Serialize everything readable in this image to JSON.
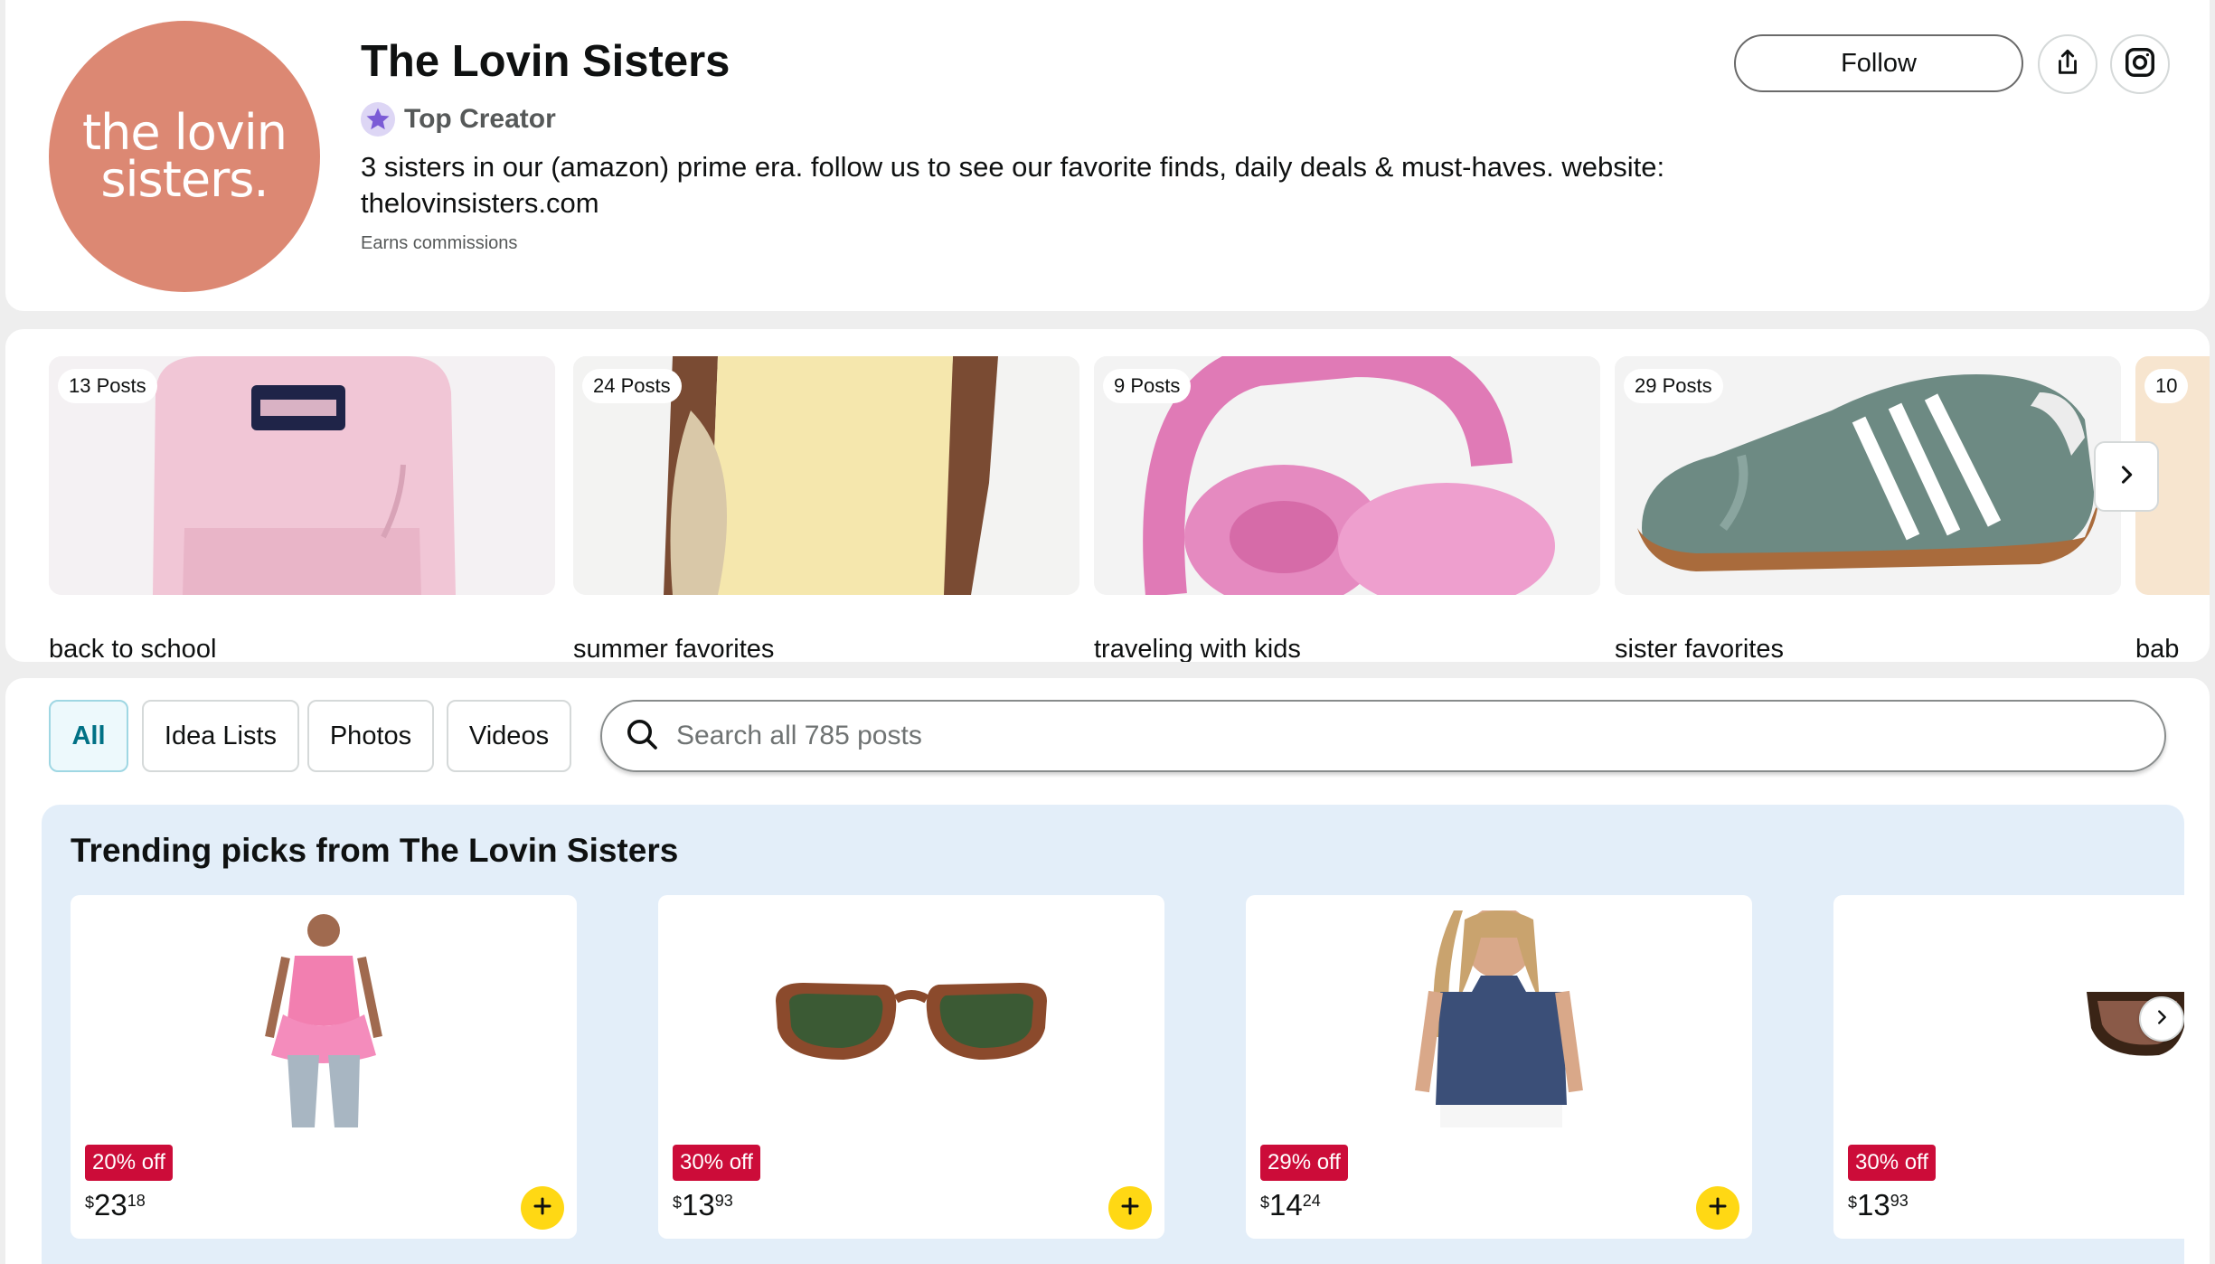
{
  "profile": {
    "avatar_line1": "the lovin",
    "avatar_line2": "sisters.",
    "name": "The Lovin Sisters",
    "badge": "Top Creator",
    "bio": "3 sisters in our (amazon) prime era. follow us to see our favorite finds, daily deals & must-haves. website: thelovinsisters.com",
    "earns": "Earns commissions",
    "follow_label": "Follow"
  },
  "idea_lists": [
    {
      "posts": "13 Posts",
      "label": "back to school",
      "icon": "pink-backpack"
    },
    {
      "posts": "24 Posts",
      "label": "summer favorites",
      "icon": "yellow-dress"
    },
    {
      "posts": "9 Posts",
      "label": "traveling with kids",
      "icon": "pink-headphones"
    },
    {
      "posts": "29 Posts",
      "label": "sister favorites",
      "icon": "green-sneaker"
    },
    {
      "posts": "10",
      "label": "bab",
      "icon": "partial-item"
    }
  ],
  "filters": {
    "tabs": [
      "All",
      "Idea Lists",
      "Photos",
      "Videos"
    ],
    "active": "All",
    "search_placeholder": "Search all 785 posts"
  },
  "trending": {
    "title": "Trending picks from The Lovin Sisters",
    "products": [
      {
        "discount": "20% off",
        "currency": "$",
        "whole": "23",
        "fraction": "18",
        "icon": "pink-top"
      },
      {
        "discount": "30% off",
        "currency": "$",
        "whole": "13",
        "fraction": "93",
        "icon": "brown-sunglasses"
      },
      {
        "discount": "29% off",
        "currency": "$",
        "whole": "14",
        "fraction": "24",
        "icon": "navy-tank"
      },
      {
        "discount": "30% off",
        "currency": "$",
        "whole": "13",
        "fraction": "93",
        "icon": "tortoise-sunglasses"
      }
    ]
  },
  "colors": {
    "avatar": "#dc8873",
    "discount_badge": "#cc0c39",
    "add_button": "#ffd814",
    "active_tab_text": "#007185",
    "trending_bg": "#e3eef9"
  }
}
